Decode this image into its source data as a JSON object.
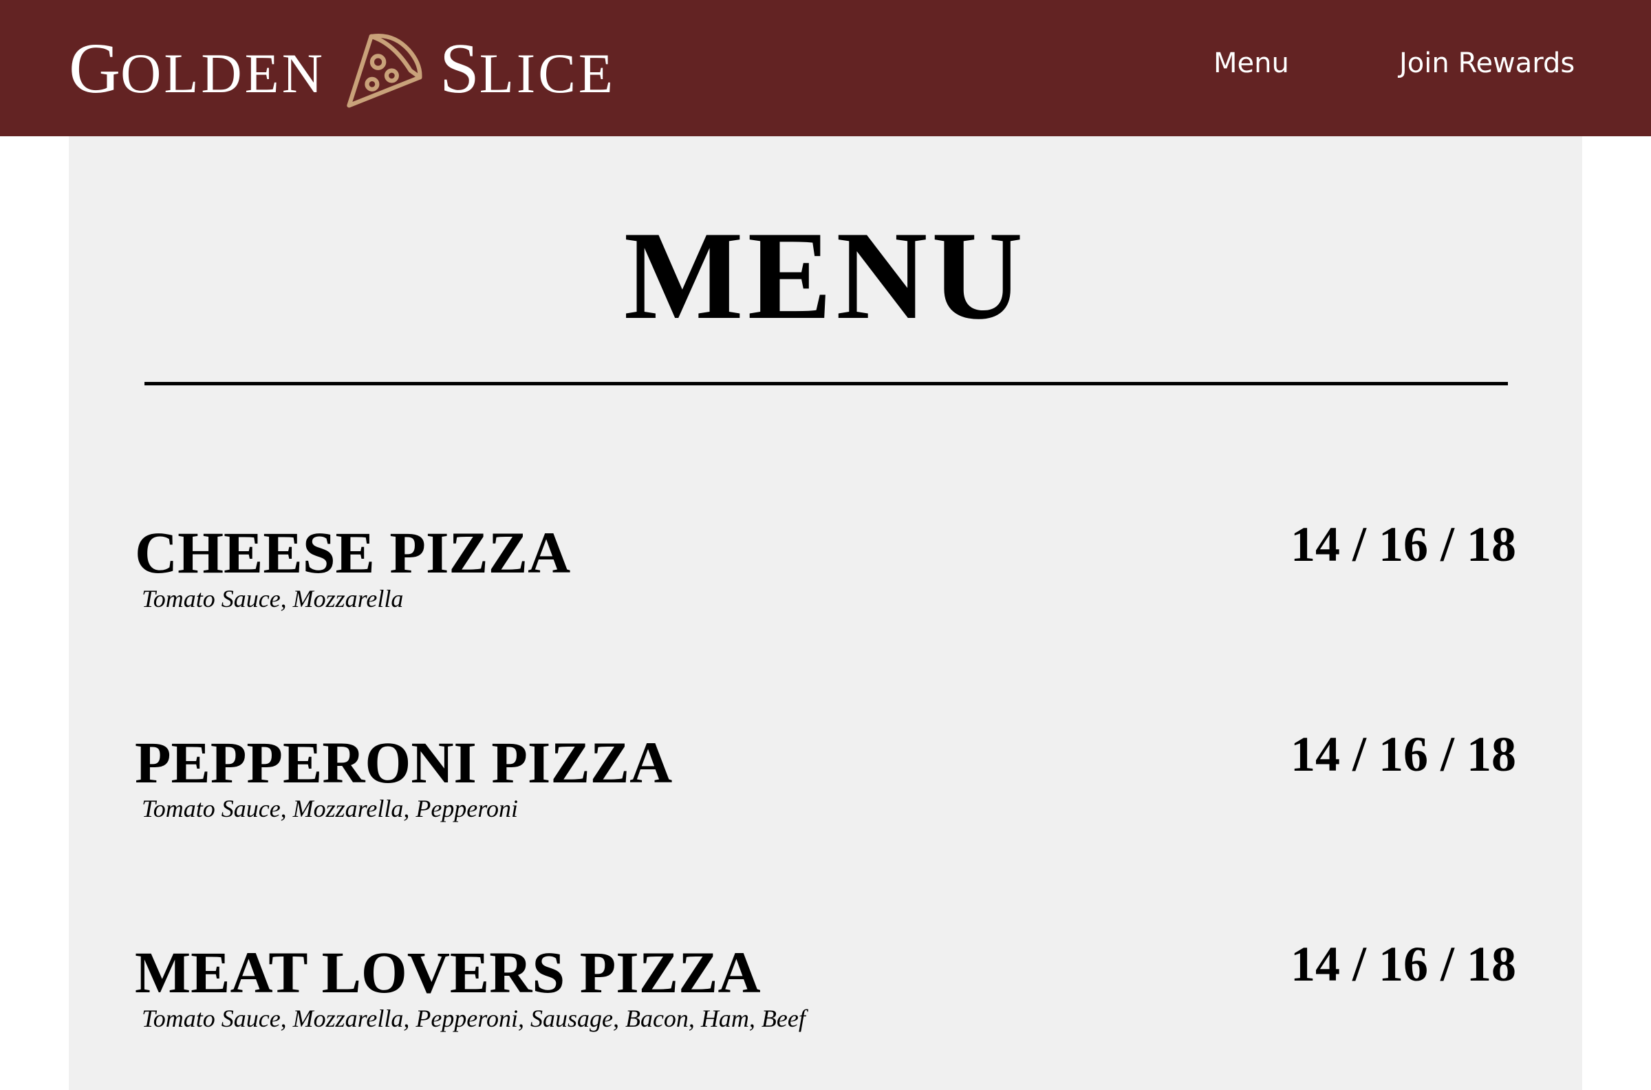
{
  "header": {
    "brand_part1_initial": "G",
    "brand_part1_rest": "OLDEN",
    "brand_part2_initial": "S",
    "brand_part2_rest": "LICE",
    "logo_icon": "pizza-slice-icon",
    "nav": [
      {
        "label": "Menu"
      },
      {
        "label": "Join Rewards"
      }
    ]
  },
  "main": {
    "title": "MENU",
    "items": [
      {
        "name": "CHEESE PIZZA",
        "description": "Tomato Sauce, Mozzarella",
        "price": "14 / 16 / 18"
      },
      {
        "name": "PEPPERONI PIZZA",
        "description": "Tomato Sauce, Mozzarella, Pepperoni",
        "price": "14 / 16 / 18"
      },
      {
        "name": "MEAT LOVERS PIZZA",
        "description": "Tomato Sauce, Mozzarella, Pepperoni, Sausage, Bacon, Ham, Beef",
        "price": "14 / 16 / 18"
      }
    ]
  },
  "colors": {
    "header_bg": "#632323",
    "content_bg": "#f0f0f0",
    "logo_icon": "#c9a27a",
    "text": "#000000",
    "nav_text": "#ffffff"
  }
}
